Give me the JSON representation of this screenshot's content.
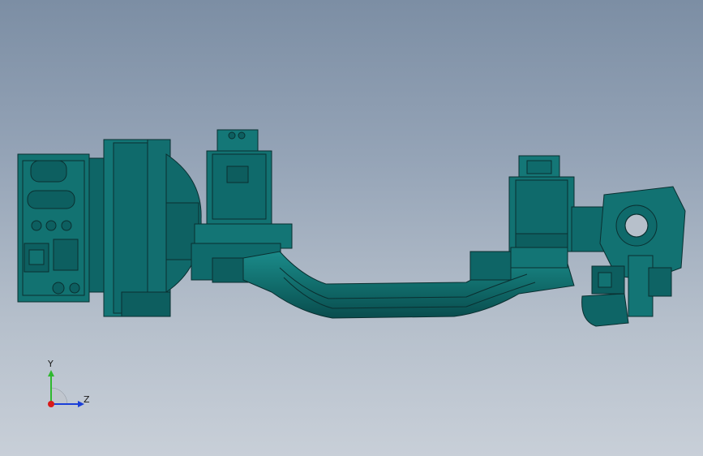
{
  "viewport": {
    "background_top": "#7c8ea4",
    "background_bottom": "#c8cfd8",
    "model_color": "#0f6a6b",
    "edge_color": "#0a2f30"
  },
  "triad": {
    "y_label": "Y",
    "z_label": "Z",
    "y_color": "#2fb82f",
    "z_color": "#1a3fd8",
    "x_color": "#d81a1a"
  }
}
